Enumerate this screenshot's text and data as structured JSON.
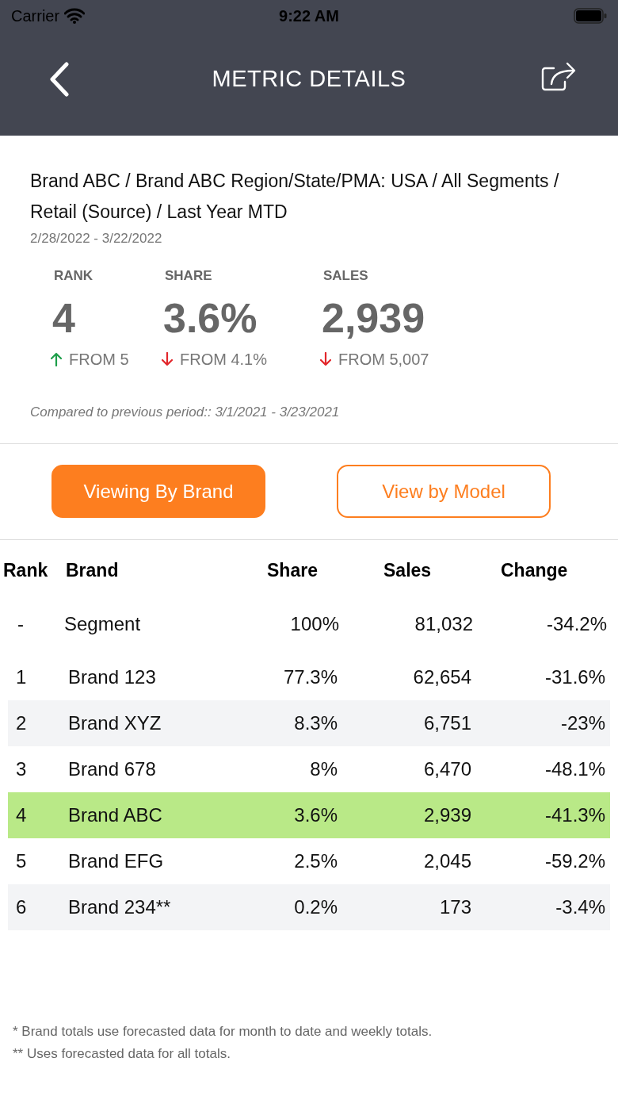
{
  "status_bar": {
    "carrier": "Carrier",
    "time": "9:22 AM"
  },
  "nav_bar": {
    "title": "METRIC DETAILS"
  },
  "summary": {
    "breadcrumb": "Brand ABC / Brand ABC Region/State/PMA: USA / All Segments / Retail (Source) / Last Year MTD",
    "date_range": "2/28/2022 - 3/22/2022",
    "metrics": [
      {
        "label": "RANK",
        "value": "4",
        "increased": true,
        "change": "FROM 5"
      },
      {
        "label": "SHARE",
        "value": "3.6%",
        "increased": false,
        "change": "FROM 4.1%"
      },
      {
        "label": "SALES",
        "value": "2,939",
        "increased": false,
        "change": "FROM 5,007"
      }
    ],
    "comparison": "Compared to previous period:: 3/1/2021 - 3/23/2021"
  },
  "view_toggle": [
    {
      "label": "Viewing By Brand",
      "selected": true
    },
    {
      "label": "View by Model",
      "selected": false
    }
  ],
  "table": {
    "columns": [
      "Rank",
      "Brand",
      "Share",
      "Sales",
      "Change"
    ],
    "rows": [
      {
        "kind": "segment",
        "highlighted": false,
        "cells": [
          "-",
          "Segment",
          "100%",
          "81,032",
          "-34.2%"
        ]
      },
      {
        "kind": "brand",
        "highlighted": false,
        "cells": [
          "1",
          "Brand 123",
          "77.3%",
          "62,654",
          "-31.6%"
        ]
      },
      {
        "kind": "brand",
        "highlighted": false,
        "cells": [
          "2",
          "Brand XYZ",
          "8.3%",
          "6,751",
          "-23%"
        ]
      },
      {
        "kind": "brand",
        "highlighted": false,
        "cells": [
          "3",
          "Brand 678",
          "8%",
          "6,470",
          "-48.1%"
        ]
      },
      {
        "kind": "brand",
        "highlighted": true,
        "cells": [
          "4",
          "Brand ABC",
          "3.6%",
          "2,939",
          "-41.3%"
        ]
      },
      {
        "kind": "brand",
        "highlighted": false,
        "cells": [
          "5",
          "Brand EFG",
          "2.5%",
          "2,045",
          "-59.2%"
        ]
      },
      {
        "kind": "brand",
        "highlighted": false,
        "cells": [
          "6",
          "Brand 234**",
          "0.2%",
          "173",
          "-3.4%"
        ]
      }
    ]
  },
  "footnotes": [
    "* Brand totals use forecasted data for month to date and weekly totals.",
    "** Uses forecasted data for all totals."
  ]
}
